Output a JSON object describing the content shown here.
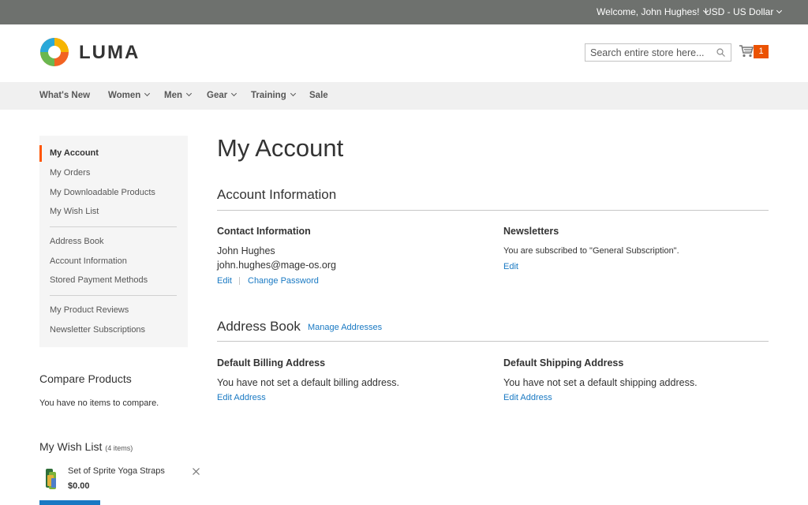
{
  "topbar": {
    "welcome": "Welcome, John Hughes!",
    "currency": "USD - US Dollar"
  },
  "header": {
    "logo_text": "LUMA",
    "search_placeholder": "Search entire store here...",
    "cart_count": "1"
  },
  "nav": {
    "items": [
      {
        "label": "What's New",
        "dropdown": false
      },
      {
        "label": "Women",
        "dropdown": true
      },
      {
        "label": "Men",
        "dropdown": true
      },
      {
        "label": "Gear",
        "dropdown": true
      },
      {
        "label": "Training",
        "dropdown": true
      },
      {
        "label": "Sale",
        "dropdown": false
      }
    ]
  },
  "sidebar": {
    "items": [
      {
        "label": "My Account",
        "active": true
      },
      {
        "label": "My Orders"
      },
      {
        "label": "My Downloadable Products"
      },
      {
        "label": "My Wish List"
      },
      {
        "label": "Address Book"
      },
      {
        "label": "Account Information"
      },
      {
        "label": "Stored Payment Methods"
      },
      {
        "label": "My Product Reviews"
      },
      {
        "label": "Newsletter Subscriptions"
      }
    ]
  },
  "compare": {
    "title": "Compare Products",
    "empty_text": "You have no items to compare."
  },
  "wishlist": {
    "title": "My Wish List",
    "count": "(4 items)",
    "item_name": "Set of Sprite Yoga Straps",
    "item_price": "$0.00"
  },
  "main": {
    "page_title": "My Account",
    "account_info": {
      "title": "Account Information",
      "contact_title": "Contact Information",
      "name": "John Hughes",
      "email": "john.hughes@mage-os.org",
      "edit": "Edit",
      "change_password": "Change Password",
      "newsletters_title": "Newsletters",
      "newsletters_text": "You are subscribed to \"General Subscription\".",
      "newsletters_edit": "Edit"
    },
    "address_book": {
      "title": "Address Book",
      "manage": "Manage Addresses",
      "billing_title": "Default Billing Address",
      "billing_text": "You have not set a default billing address.",
      "billing_edit": "Edit Address",
      "shipping_title": "Default Shipping Address",
      "shipping_text": "You have not set a default shipping address.",
      "shipping_edit": "Edit Address"
    }
  },
  "colors": {
    "topbar": "#6e716e",
    "accent": "#ff5501",
    "link": "#1979c3",
    "cart_badge": "#eb5202"
  }
}
